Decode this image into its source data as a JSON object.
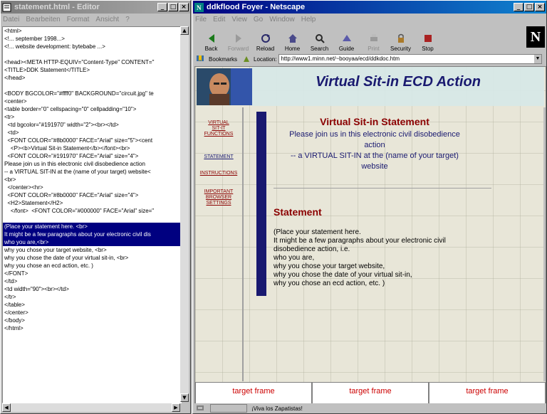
{
  "editor": {
    "title": "statement.html - Editor",
    "menu": [
      "Datei",
      "Bearbeiten",
      "Format",
      "Ansicht",
      "?"
    ],
    "lines": [
      "<html>",
      "<!... september 1998...>",
      "<!... website development: bytebabe ...>",
      "",
      "<head><META HTTP-EQUIV=\"Content-Type\" CONTENT=\"",
      "<TITLE>DDK Statement</TITLE>",
      "</head>",
      "",
      "<BODY BGCOLOR=\"#ffff0\" BACKGROUND=\"circuit.jpg\" te",
      "<center>",
      "<table border=\"0\" cellspacing=\"0\" cellpadding=\"10\">",
      "<tr>",
      "  <td bgcolor=\"#191970\" width=\"2\"><br></td>",
      "  <td>",
      "  <FONT COLOR=\"#8b0000\" FACE=\"Arial\" size=\"5\"><cent",
      "    <P><b>Virtual Sit-in Statement</b></font><br>",
      "  <FONT COLOR=\"#191970\" FACE=\"Arial\" size=\"4\">",
      "Please join us in this electronic civil disobedience action",
      "-- a VIRTUAL SIT-IN at the (name of your target) website<",
      "<br>",
      "  </center><hr>",
      "  <FONT COLOR=\"#8b0000\" FACE=\"Arial\" size=\"4\">",
      "  <H2>Statement</H2>",
      "    </font>  <FONT COLOR=\"#000000\" FACE=\"Arial\" size=\"",
      "",
      "(Place your statement here. <br>",
      "It might be a few paragraphs about your electronic civil dis",
      "who you are,<br>",
      "why you chose your target website, <br>",
      "why you chose the date of your virtual sit-in, <br>",
      "why you chose an ecd action, etc. )",
      "</FONT>",
      "</td>",
      "<td width=\"90\"><br></td>",
      "</tr>",
      "</table>",
      "</center>",
      "</body>",
      "</html>"
    ],
    "selected_lines": [
      25,
      26,
      27
    ]
  },
  "browser": {
    "title": "ddkflood Foyer - Netscape",
    "menu": [
      "File",
      "Edit",
      "View",
      "Go",
      "Window",
      "Help"
    ],
    "toolbar": [
      {
        "label": "Back",
        "icon": "back-arrow-icon",
        "enabled": true
      },
      {
        "label": "Forward",
        "icon": "forward-arrow-icon",
        "enabled": false
      },
      {
        "label": "Reload",
        "icon": "reload-icon",
        "enabled": true
      },
      {
        "label": "Home",
        "icon": "home-icon",
        "enabled": true
      },
      {
        "label": "Search",
        "icon": "search-icon",
        "enabled": true
      },
      {
        "label": "Guide",
        "icon": "guide-icon",
        "enabled": true
      },
      {
        "label": "Print",
        "icon": "print-icon",
        "enabled": false
      },
      {
        "label": "Security",
        "icon": "lock-icon",
        "enabled": true
      },
      {
        "label": "Stop",
        "icon": "stop-icon",
        "enabled": true
      }
    ],
    "bookmarks_label": "Bookmarks",
    "location_label": "Location:",
    "url": "http://www1.minn.net/~booyaa/ecd/ddkdoc.htm",
    "status_text": "¡Viva los Zapatistas!"
  },
  "page": {
    "header_title": "Virtual Sit-in ECD Action",
    "nav": [
      [
        "VIRTUAL",
        "SIT-IT",
        "FUNCTIONS"
      ],
      [
        "STATEMENT"
      ],
      [
        "INSTRUCTIONS"
      ],
      [
        "IMPORTANT",
        "BROWSER",
        "SETTINGS"
      ]
    ],
    "main_title": "Virtual Sit-in Statement",
    "main_subtitle": [
      "Please join us in this electronic civil disobedience",
      "action",
      "-- a VIRTUAL SIT-IN at the (name of your target)",
      "website"
    ],
    "section_heading": "Statement",
    "body": [
      "(Place your statement here.",
      "It might be a few paragraphs about your electronic civil",
      "disobedience action, i.e.",
      "who you are,",
      "why you chose your target website,",
      "why you chose the date of your virtual sit-in,",
      "why you chose an ecd action, etc. )"
    ],
    "target_frames": [
      "target frame",
      "target frame",
      "target frame"
    ],
    "colors": {
      "title_blue": "#191970",
      "dark_red": "#8b0000",
      "link_red": "#cc0000",
      "navy_bar": "#191970"
    }
  }
}
